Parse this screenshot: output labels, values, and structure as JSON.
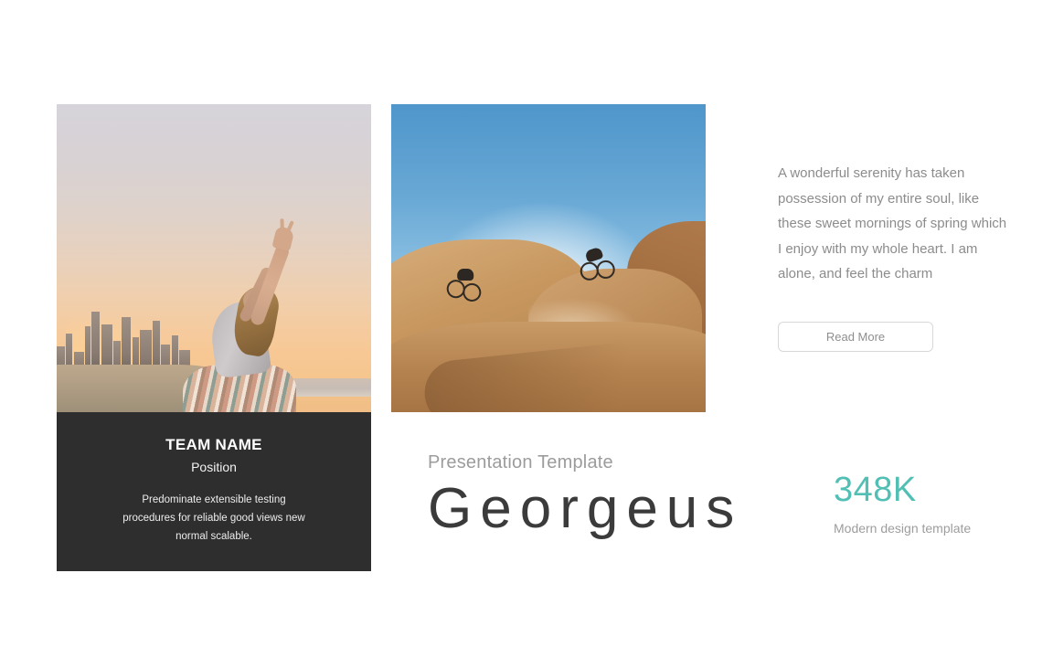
{
  "slide": {
    "background_color": "#ffffff"
  },
  "team_card": {
    "photo": {
      "alt": "woman stretching arms on beach at sunset with city skyline",
      "icon": "beach-sunset-photo"
    },
    "name": "TEAM NAME",
    "position": "Position",
    "description": "Predominate extensible testing procedures for reliable good views new normal scalable.",
    "panel_color": "#2e2e2e"
  },
  "feature_photo": {
    "alt": "two mountain bikers riding down a desert canyon ridge",
    "icon": "mountain-bike-photo"
  },
  "right_column": {
    "paragraph": "A wonderful serenity has taken possession of my entire soul, like these sweet mornings of spring which I enjoy with my whole heart. I am alone, and feel the charm",
    "read_more_label": "Read More"
  },
  "title_block": {
    "eyebrow": "Presentation Template",
    "title": "Georgeus"
  },
  "stat_block": {
    "value": "348K",
    "label": "Modern design template",
    "accent_color": "#52bfb4"
  }
}
